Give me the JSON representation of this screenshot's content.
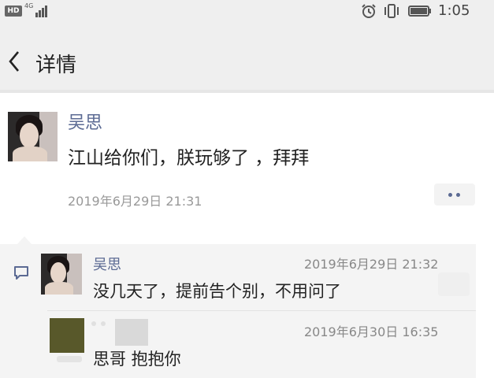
{
  "status_bar": {
    "hd_label": "HD",
    "network_label": "4G",
    "time": "1:05",
    "icons": [
      "alarm-icon",
      "vibrate-icon",
      "battery-icon",
      "signal-icon"
    ]
  },
  "nav": {
    "back_icon": "chevron-left-icon",
    "title": "详情"
  },
  "post": {
    "author": "吴思",
    "text": "江山给你们，朕玩够了 ，拜拜",
    "time": "2019年6月29日 21:31",
    "more_icon": "more-dots-icon"
  },
  "comments": {
    "icon": "comment-icon",
    "items": [
      {
        "author": "吴思",
        "time": "2019年6月29日 21:32",
        "text": "没几天了，提前告个别，不用问了"
      },
      {
        "time": "2019年6月30日 16:35",
        "text": "思哥 抱抱你"
      }
    ]
  },
  "colors": {
    "name_link": "#5b6a93",
    "secondary_text": "#999999",
    "header_bg": "#efefef",
    "comment_bg": "#f4f4f4"
  }
}
